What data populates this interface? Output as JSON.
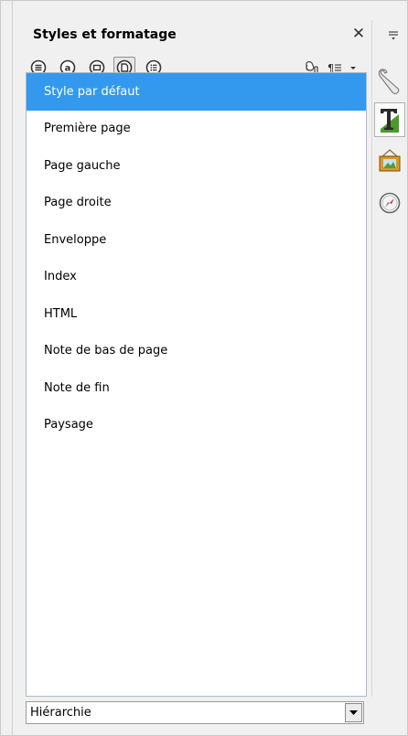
{
  "panel": {
    "title": "Styles et formatage",
    "close_symbol": "✕"
  },
  "toolbar": {
    "buttons": [
      {
        "icon": "paragraph-styles-icon",
        "label": "Styles de paragraphe"
      },
      {
        "icon": "character-styles-icon",
        "label": "Styles de caractère"
      },
      {
        "icon": "frame-styles-icon",
        "label": "Styles de cadre"
      },
      {
        "icon": "page-styles-icon",
        "label": "Styles de page",
        "active": true
      },
      {
        "icon": "list-styles-icon",
        "label": "Styles de liste"
      }
    ],
    "right": [
      "fill-format-mode-icon",
      "new-style-menu-icon"
    ]
  },
  "styles_list": [
    {
      "label": "Style par défaut",
      "selected": true
    },
    {
      "label": "Première page"
    },
    {
      "label": "Page gauche"
    },
    {
      "label": "Page droite"
    },
    {
      "label": "Enveloppe"
    },
    {
      "label": "Index"
    },
    {
      "label": "HTML"
    },
    {
      "label": "Note de bas de page"
    },
    {
      "label": "Note de fin"
    },
    {
      "label": "Paysage"
    }
  ],
  "filter": {
    "selected": "Hiérarchie"
  },
  "sidebar": {
    "buttons": [
      "menu-icon",
      "properties-icon",
      "styles-icon",
      "gallery-icon",
      "navigator-icon"
    ]
  },
  "colors": {
    "selection": "#3399ee",
    "list_border": "#aeb9c5"
  }
}
